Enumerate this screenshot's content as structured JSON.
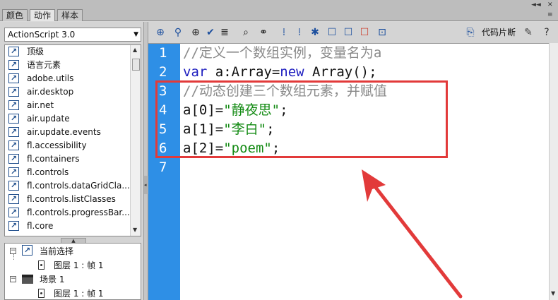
{
  "tabs": [
    {
      "label": "颜色"
    },
    {
      "label": "动作"
    },
    {
      "label": "样本"
    }
  ],
  "active_tab_index": 1,
  "window_controls": {
    "collapse": "◄◄",
    "close": "✕",
    "menu": "≡"
  },
  "library": {
    "version_select": "ActionScript 3.0",
    "items": [
      {
        "label": "顶级"
      },
      {
        "label": "语言元素"
      },
      {
        "label": "adobe.utils"
      },
      {
        "label": "air.desktop"
      },
      {
        "label": "air.net"
      },
      {
        "label": "air.update"
      },
      {
        "label": "air.update.events"
      },
      {
        "label": "fl.accessibility"
      },
      {
        "label": "fl.containers"
      },
      {
        "label": "fl.controls"
      },
      {
        "label": "fl.controls.dataGridCla..."
      },
      {
        "label": "fl.controls.listClasses"
      },
      {
        "label": "fl.controls.progressBar..."
      },
      {
        "label": "fl.core"
      }
    ]
  },
  "tree": {
    "items": [
      {
        "label": "当前选择"
      },
      {
        "label": "图层 1 : 帧 1"
      },
      {
        "label": "场景 1"
      },
      {
        "label": "图层 1 : 帧 1"
      }
    ]
  },
  "toolbar": {
    "icons": [
      "add-statement-icon",
      "find-icon",
      "target-icon",
      "check-syntax-icon",
      "auto-format-icon",
      "code-hint-icon",
      "debug-options-icon",
      "collapse-braces-icon",
      "collapse-selection-icon",
      "expand-all-icon",
      "block-comment-icon",
      "line-comment-icon",
      "remove-comment-icon",
      "show-hide-toolbox-icon"
    ],
    "snippets_label": "代码片断",
    "help": "?"
  },
  "code": {
    "lines": [
      {
        "num": "1",
        "text": "//定义一个数组实例，变量名为a"
      },
      {
        "num": "2",
        "kw1": "var",
        "mid": " a:Array=",
        "kw2": "new",
        "rest": " Array();"
      },
      {
        "num": "3",
        "text": "//动态创建三个数组元素，并赋值"
      },
      {
        "num": "4",
        "pre": "a[0]=",
        "str": "\"静夜思\"",
        "post": ";"
      },
      {
        "num": "5",
        "pre": "a[1]=",
        "str": "\"李白\"",
        "post": ";"
      },
      {
        "num": "6",
        "pre": "a[2]=",
        "str": "\"poem\"",
        "post": ";"
      },
      {
        "num": "7"
      }
    ]
  },
  "colors": {
    "gutter": "#2e8fe6",
    "annotation": "#e23a3a",
    "keyword": "#1d1dbf",
    "string": "#128a12",
    "comment": "#8a8a8a"
  }
}
